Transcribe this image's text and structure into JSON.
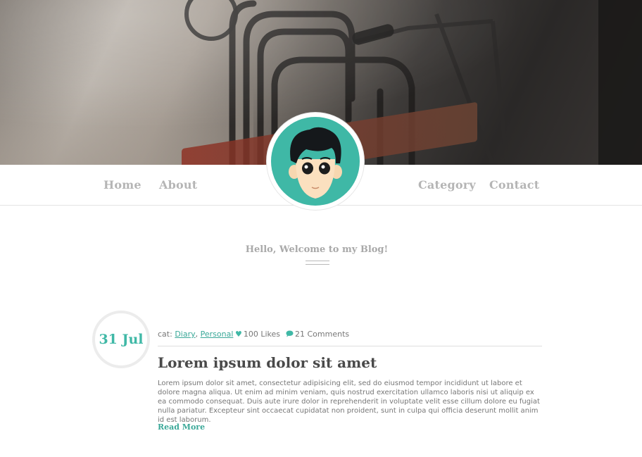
{
  "nav": {
    "home": "Home",
    "about": "About",
    "category": "Category",
    "contact": "Contact"
  },
  "welcome": "Hello, Welcome to my Blog!",
  "post": {
    "date": "31 Jul",
    "cat_prefix": "cat:",
    "categories": [
      "Diary",
      "Personal"
    ],
    "likes": "100 Likes",
    "comments": "21 Comments",
    "title": "Lorem ipsum dolor sit amet",
    "excerpt": "Lorem ipsum dolor sit amet, consectetur adipisicing elit, sed do eiusmod tempor incididunt ut labore et dolore magna aliqua. Ut enim ad minim veniam, quis nostrud exercitation ullamco laboris nisi ut aliquip ex ea commodo consequat. Duis aute irure dolor in reprehenderit in voluptate velit esse cillum dolore eu fugiat nulla pariatur. Excepteur sint occaecat cupidatat non proident, sunt in culpa qui officia deserunt mollit anim id est laborum.",
    "read_more": "Read More"
  },
  "colors": {
    "accent": "#3fb8a6",
    "nav_text": "#b5b5b5",
    "avatar_bg": "#3fb8a6"
  },
  "icons": {
    "likes": "heart-icon",
    "comments": "comment-icon"
  }
}
